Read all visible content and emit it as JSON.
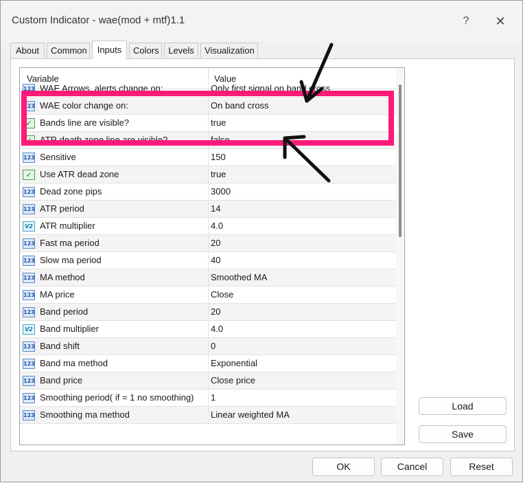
{
  "window": {
    "title": "Custom Indicator - wae(mod + mtf)1.1",
    "help_glyph": "?",
    "close_glyph": "✕"
  },
  "tabs": [
    {
      "label": "About"
    },
    {
      "label": "Common"
    },
    {
      "label": "Inputs"
    },
    {
      "label": "Colors"
    },
    {
      "label": "Levels"
    },
    {
      "label": "Visualization"
    }
  ],
  "table": {
    "headers": {
      "variable": "Variable",
      "value": "Value"
    },
    "rows": [
      {
        "type": "int",
        "badge": "123",
        "variable": "WAE Arrows, alerts change on:",
        "value": "Only first signal on band cross"
      },
      {
        "type": "int",
        "badge": "123",
        "variable": "WAE color change on:",
        "value": "On band cross"
      },
      {
        "type": "bool",
        "badge": "✓",
        "variable": "Bands line are visible?",
        "value": "true"
      },
      {
        "type": "bool",
        "badge": "✓",
        "variable": "ATR death zone line are visible?",
        "value": "false"
      },
      {
        "type": "int",
        "badge": "123",
        "variable": "Sensitive",
        "value": "150"
      },
      {
        "type": "bool",
        "badge": "✓",
        "variable": "Use ATR dead zone",
        "value": "true"
      },
      {
        "type": "int",
        "badge": "123",
        "variable": "Dead zone pips",
        "value": "3000"
      },
      {
        "type": "int",
        "badge": "123",
        "variable": "ATR period",
        "value": "14"
      },
      {
        "type": "double",
        "badge": "V2",
        "variable": "ATR multiplier",
        "value": "4.0"
      },
      {
        "type": "int",
        "badge": "123",
        "variable": "Fast ma period",
        "value": "20"
      },
      {
        "type": "int",
        "badge": "123",
        "variable": "Slow ma period",
        "value": "40"
      },
      {
        "type": "int",
        "badge": "123",
        "variable": "MA method",
        "value": "Smoothed MA"
      },
      {
        "type": "int",
        "badge": "123",
        "variable": "MA price",
        "value": "Close"
      },
      {
        "type": "int",
        "badge": "123",
        "variable": "Band period",
        "value": "20"
      },
      {
        "type": "double",
        "badge": "V2",
        "variable": "Band multiplier",
        "value": "4.0"
      },
      {
        "type": "int",
        "badge": "123",
        "variable": "Band shift",
        "value": "0"
      },
      {
        "type": "int",
        "badge": "123",
        "variable": "Band ma method",
        "value": "Exponential"
      },
      {
        "type": "int",
        "badge": "123",
        "variable": "Band price",
        "value": "Close price"
      },
      {
        "type": "int",
        "badge": "123",
        "variable": "Smoothing period( if = 1 no smoothing)",
        "value": "1"
      },
      {
        "type": "int",
        "badge": "123",
        "variable": "Smoothing ma method",
        "value": "Linear weighted MA"
      }
    ]
  },
  "buttons": {
    "load": "Load",
    "save": "Save",
    "ok": "OK",
    "cancel": "Cancel",
    "reset": "Reset"
  },
  "colors": {
    "highlight": "#ff1a7a",
    "arrow": "#111111"
  }
}
